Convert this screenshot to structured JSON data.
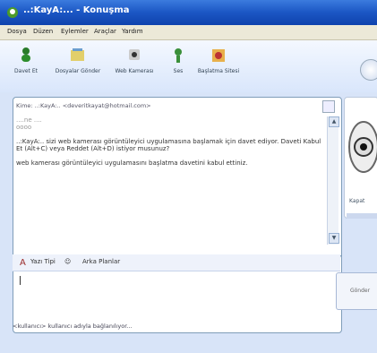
{
  "window": {
    "title": "..:KayA:... - Konuşma"
  },
  "menu": [
    "Dosya",
    "Düzen",
    "Eylemler",
    "Araçlar",
    "Yardım"
  ],
  "toolbar": {
    "items": [
      {
        "label": "Davet Et",
        "icon": "invite-icon"
      },
      {
        "label": "Dosyalar Gönder",
        "icon": "send-files-icon"
      },
      {
        "label": "Web Kamerası",
        "icon": "webcam-icon"
      },
      {
        "label": "Ses",
        "icon": "voice-icon"
      },
      {
        "label": "Başlatma Sitesi",
        "icon": "start-site-icon"
      }
    ]
  },
  "conversation": {
    "to_label": "Kime:",
    "to_value": "..:KayA:.. <deveritkayat@hotmail.com>",
    "lines": [
      "....ne ....",
      "oooo",
      "..:KayA:.. sizi web kamerası görüntüleyici uygulamasına başlamak için davet ediyor. Daveti Kabul Et (Alt+C) veya Reddet (Alt+D) istiyor musunuz?",
      "web kamerası görüntüleyici uygulamasını başlatma davetini kabul ettiniz."
    ]
  },
  "format_bar": {
    "font_label": "Yazı Tipi",
    "emoticon": "☺",
    "bg_label": "Arka Planlar"
  },
  "send": {
    "label": "Gönder"
  },
  "status": {
    "text": "<kullanıcı> kullanıcı adıyla bağlanılıyor..."
  },
  "webcam": {
    "label": "Kapat"
  },
  "colors": {
    "title_bar": "#1b56c4",
    "frame_border": "#7f9db9"
  }
}
